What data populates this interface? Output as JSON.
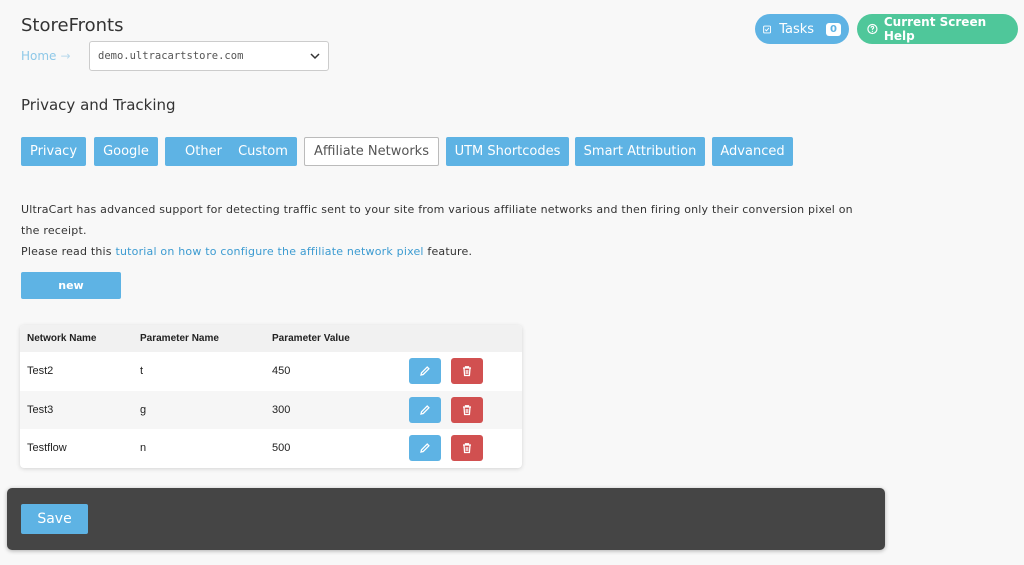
{
  "header": {
    "title": "StoreFronts",
    "breadcrumb_home": "Home",
    "breadcrumb_arrow": "→",
    "store_select_value": "demo.ultracartstore.com"
  },
  "top_buttons": {
    "tasks_label": "Tasks",
    "tasks_count": "0",
    "help_label": "Current Screen Help"
  },
  "section_title": "Privacy and Tracking",
  "tabs": [
    {
      "label": "Privacy"
    },
    {
      "label": "Google"
    },
    {
      "label": "Other"
    },
    {
      "label": "Custom"
    },
    {
      "label": "Affiliate Networks"
    },
    {
      "label": "UTM Shortcodes"
    },
    {
      "label": "Smart Attribution"
    },
    {
      "label": "Advanced"
    }
  ],
  "active_tab": "Affiliate Networks",
  "description": {
    "line1": "UltraCart has advanced support for detecting traffic sent to your site from various affiliate networks and then firing only their conversion pixel on the receipt.",
    "line2_prefix": "Please read this ",
    "line2_link": "tutorial on how to configure the affiliate network pixel",
    "line2_suffix": " feature."
  },
  "new_button_label": "new",
  "table": {
    "headers": [
      "Network Name",
      "Parameter Name",
      "Parameter Value"
    ],
    "rows": [
      {
        "network": "Test2",
        "param_name": "t",
        "param_value": "450"
      },
      {
        "network": "Test3",
        "param_name": "g",
        "param_value": "300"
      },
      {
        "network": "Testflow",
        "param_name": "n",
        "param_value": "500"
      }
    ]
  },
  "save_button_label": "Save",
  "colors": {
    "primary": "#5eb3e4",
    "help_green": "#4fc79a",
    "delete_red": "#d15050",
    "savebar_bg": "#454545"
  }
}
